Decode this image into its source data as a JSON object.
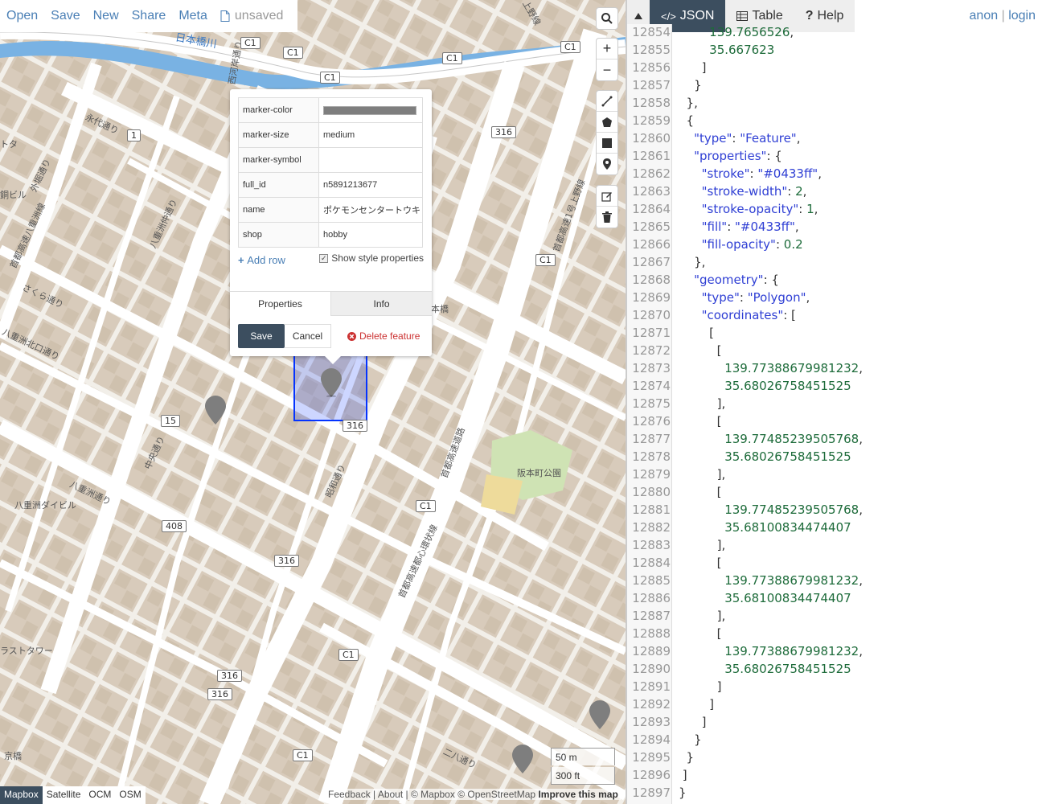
{
  "menu": {
    "open": "Open",
    "save": "Save",
    "new": "New",
    "share": "Share",
    "meta": "Meta",
    "unsaved": "unsaved"
  },
  "map": {
    "labels": [
      {
        "text": "日本橋川",
        "cls": "river"
      },
      {
        "text": "永代通り"
      },
      {
        "text": "外堀通り"
      },
      {
        "text": "八重洲仲通り"
      },
      {
        "text": "首都高速八重洲線"
      },
      {
        "text": "さくら通り"
      },
      {
        "text": "八重洲北口通り"
      },
      {
        "text": "八重洲ダイビル"
      },
      {
        "text": "中央通り"
      },
      {
        "text": "昭和通り"
      },
      {
        "text": "首都高速都心環状線"
      },
      {
        "text": "阪本町公園"
      },
      {
        "text": "二八通り"
      },
      {
        "text": "京橋"
      },
      {
        "text": "ラストタワー"
      },
      {
        "text": "銅ビル"
      },
      {
        "text": "トタ"
      },
      {
        "text": "上野線"
      },
      {
        "text": "首都高速1号上野線"
      },
      {
        "text": "本橋"
      },
      {
        "text": "西河岸通り"
      },
      {
        "text": "八重洲通り"
      },
      {
        "text": "首都高速道路"
      }
    ],
    "shields": [
      "C1",
      "C1",
      "C1",
      "C1",
      "C1",
      "316",
      "1",
      "C1",
      "15",
      "316",
      "408",
      "316",
      "C1",
      "C1",
      "316",
      "316",
      "C1"
    ],
    "layers": [
      "Mapbox",
      "Satellite",
      "OCM",
      "OSM"
    ],
    "active_layer": "Mapbox",
    "attribution": {
      "feedback": "Feedback",
      "about": "About",
      "mapbox": "© Mapbox",
      "osm": "© OpenStreetMap",
      "improve": "Improve this map"
    },
    "scale": {
      "metric": "50 m",
      "imperial": "300 ft"
    },
    "controls": {
      "search": "search-icon",
      "zoom_in": "+",
      "zoom_out": "−"
    }
  },
  "popup": {
    "rows": [
      {
        "key": "marker-color",
        "value": "",
        "is_color": true
      },
      {
        "key": "marker-size",
        "value": "medium"
      },
      {
        "key": "marker-symbol",
        "value": ""
      },
      {
        "key": "full_id",
        "value": "n5891213677"
      },
      {
        "key": "name",
        "value": "ポケモンセンタートウキ"
      },
      {
        "key": "shop",
        "value": "hobby"
      }
    ],
    "marker_color": "#7e7e7e",
    "add_row": "Add row",
    "show_style": "Show style properties",
    "show_style_checked": true,
    "tab_properties": "Properties",
    "tab_info": "Info",
    "save": "Save",
    "cancel": "Cancel",
    "delete": "Delete feature"
  },
  "editor": {
    "tabs": {
      "json": "JSON",
      "table": "Table",
      "help": "Help"
    },
    "active_tab": "JSON",
    "auth": {
      "anon": "anon",
      "sep": "|",
      "login": "login"
    },
    "lines": [
      {
        "n": "12854",
        "t": "        139.7656526,"
      },
      {
        "n": "12855",
        "t": "        35.667623"
      },
      {
        "n": "12856",
        "t": "      ]"
      },
      {
        "n": "12857",
        "t": "    }"
      },
      {
        "n": "12858",
        "t": "  },"
      },
      {
        "n": "12859",
        "t": "  {"
      },
      {
        "n": "12860",
        "t": "    \"type\": \"Feature\","
      },
      {
        "n": "12861",
        "t": "    \"properties\": {"
      },
      {
        "n": "12862",
        "t": "      \"stroke\": \"#0433ff\","
      },
      {
        "n": "12863",
        "t": "      \"stroke-width\": 2,"
      },
      {
        "n": "12864",
        "t": "      \"stroke-opacity\": 1,"
      },
      {
        "n": "12865",
        "t": "      \"fill\": \"#0433ff\","
      },
      {
        "n": "12866",
        "t": "      \"fill-opacity\": 0.2"
      },
      {
        "n": "12867",
        "t": "    },"
      },
      {
        "n": "12868",
        "t": "    \"geometry\": {"
      },
      {
        "n": "12869",
        "t": "      \"type\": \"Polygon\","
      },
      {
        "n": "12870",
        "t": "      \"coordinates\": ["
      },
      {
        "n": "12871",
        "t": "        ["
      },
      {
        "n": "12872",
        "t": "          ["
      },
      {
        "n": "12873",
        "t": "            139.77388679981232,"
      },
      {
        "n": "12874",
        "t": "            35.68026758451525"
      },
      {
        "n": "12875",
        "t": "          ],"
      },
      {
        "n": "12876",
        "t": "          ["
      },
      {
        "n": "12877",
        "t": "            139.77485239505768,"
      },
      {
        "n": "12878",
        "t": "            35.68026758451525"
      },
      {
        "n": "12879",
        "t": "          ],"
      },
      {
        "n": "12880",
        "t": "          ["
      },
      {
        "n": "12881",
        "t": "            139.77485239505768,"
      },
      {
        "n": "12882",
        "t": "            35.68100834474407"
      },
      {
        "n": "12883",
        "t": "          ],"
      },
      {
        "n": "12884",
        "t": "          ["
      },
      {
        "n": "12885",
        "t": "            139.77388679981232,"
      },
      {
        "n": "12886",
        "t": "            35.68100834474407"
      },
      {
        "n": "12887",
        "t": "          ],"
      },
      {
        "n": "12888",
        "t": "          ["
      },
      {
        "n": "12889",
        "t": "            139.77388679981232,"
      },
      {
        "n": "12890",
        "t": "            35.68026758451525"
      },
      {
        "n": "12891",
        "t": "          ]"
      },
      {
        "n": "12892",
        "t": "        ]"
      },
      {
        "n": "12893",
        "t": "      ]"
      },
      {
        "n": "12894",
        "t": "    }"
      },
      {
        "n": "12895",
        "t": "  }"
      },
      {
        "n": "12896",
        "t": " ]"
      },
      {
        "n": "12897",
        "t": "}"
      }
    ]
  },
  "colors": {
    "accent": "#3c4e5f",
    "link": "#4a7fb5",
    "selection": "#0433ff",
    "delete": "#cc3333",
    "json_key": "#2f3fd4",
    "json_number": "#1d6b3a"
  }
}
